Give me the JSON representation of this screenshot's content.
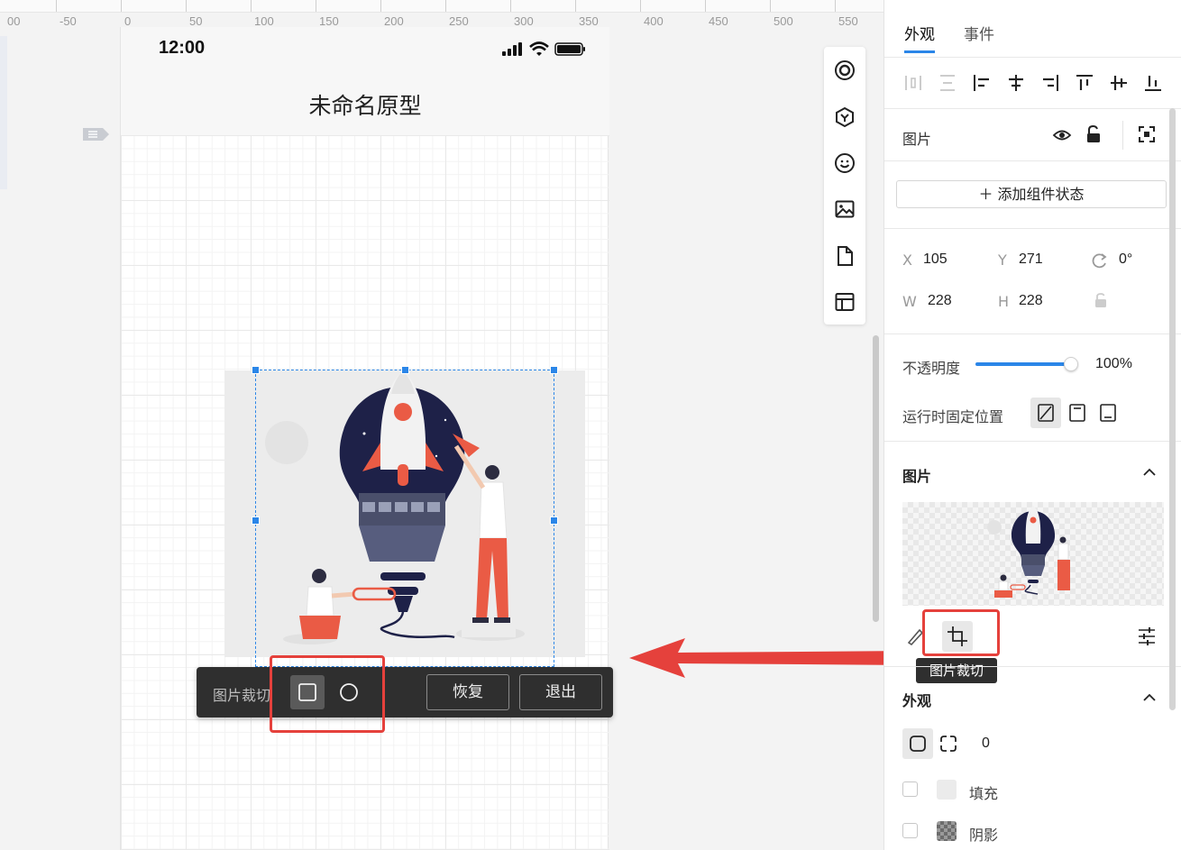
{
  "ruler": {
    "labels": [
      "00",
      "-50",
      "0",
      "50",
      "100",
      "150",
      "200",
      "250",
      "300",
      "350",
      "400",
      "450",
      "500",
      "550"
    ]
  },
  "phone": {
    "time": "12:00",
    "title": "未命名原型"
  },
  "crop_toolbar": {
    "label": "图片裁切",
    "restore": "恢复",
    "exit": "退出",
    "shape_icons": [
      "crop-square-icon",
      "crop-circle-icon"
    ]
  },
  "tool_strip": {
    "icons": [
      "target-icon",
      "component-icon",
      "emoji-icon",
      "image-icon",
      "page-icon",
      "layout-icon"
    ]
  },
  "panel": {
    "tabs": [
      "外观",
      "事件"
    ],
    "align_icons": [
      "distribute-horizontal-icon",
      "distribute-vertical-icon",
      "align-left-icon",
      "align-center-horizontal-icon",
      "align-right-icon",
      "align-top-icon",
      "align-middle-vertical-icon",
      "align-bottom-icon"
    ],
    "component_name": "图片",
    "add_state": "＋ 添加组件状态",
    "geometry": {
      "x_label": "X",
      "x": "105",
      "y_label": "Y",
      "y": "271",
      "rotation": "0°",
      "w_label": "W",
      "w": "228",
      "h_label": "H",
      "h": "228"
    },
    "opacity": {
      "label": "不透明度",
      "value": "100%",
      "level": 1.0
    },
    "fixed_position": {
      "label": "运行时固定位置"
    },
    "image_section": {
      "title": "图片"
    },
    "crop_tooltip": "图片裁切",
    "appearance": {
      "title": "外观",
      "radius": "0"
    },
    "fill": {
      "label": "填充"
    },
    "shadow": {
      "label": "阴影"
    }
  },
  "colors": {
    "accent": "#2b86e8",
    "highlight": "#e5413c",
    "toolbar_bg": "#2f2f2f"
  }
}
